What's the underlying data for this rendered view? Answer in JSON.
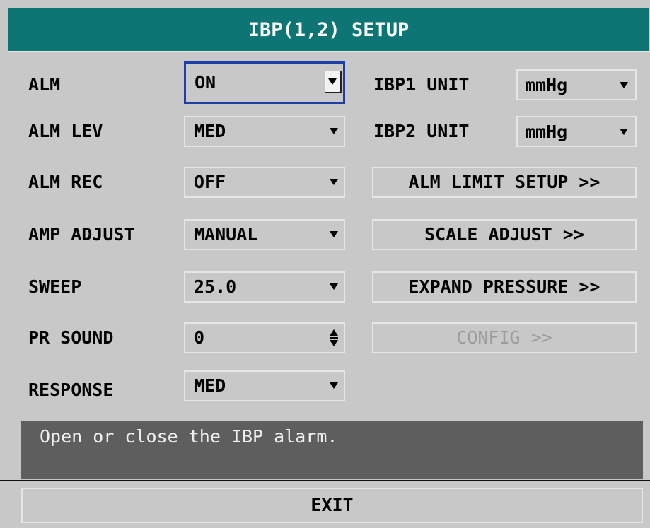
{
  "title": "IBP(1,2) SETUP",
  "left_settings": [
    {
      "label": "ALM",
      "value": "ON"
    },
    {
      "label": "ALM LEV",
      "value": "MED"
    },
    {
      "label": "ALM REC",
      "value": "OFF"
    },
    {
      "label": "AMP ADJUST",
      "value": "MANUAL"
    },
    {
      "label": "SWEEP",
      "value": "25.0"
    },
    {
      "label": "PR SOUND",
      "value": "0"
    },
    {
      "label": "RESPONSE",
      "value": "MED"
    }
  ],
  "units": [
    {
      "label": "IBP1 UNIT",
      "value": "mmHg"
    },
    {
      "label": "IBP2 UNIT",
      "value": "mmHg"
    }
  ],
  "buttons": {
    "alm_limit_setup": "ALM LIMIT SETUP >>",
    "scale_adjust": "SCALE ADJUST >>",
    "expand_pressure": "EXPAND PRESSURE >>",
    "config": "CONFIG >>"
  },
  "status_text": "Open or close the IBP alarm.",
  "exit_label": "EXIT",
  "colors": {
    "title_bar": "#0e7575",
    "background": "#c8c8c8",
    "focus_border": "#1d3ea8",
    "status_bg": "#5e5e5e"
  }
}
